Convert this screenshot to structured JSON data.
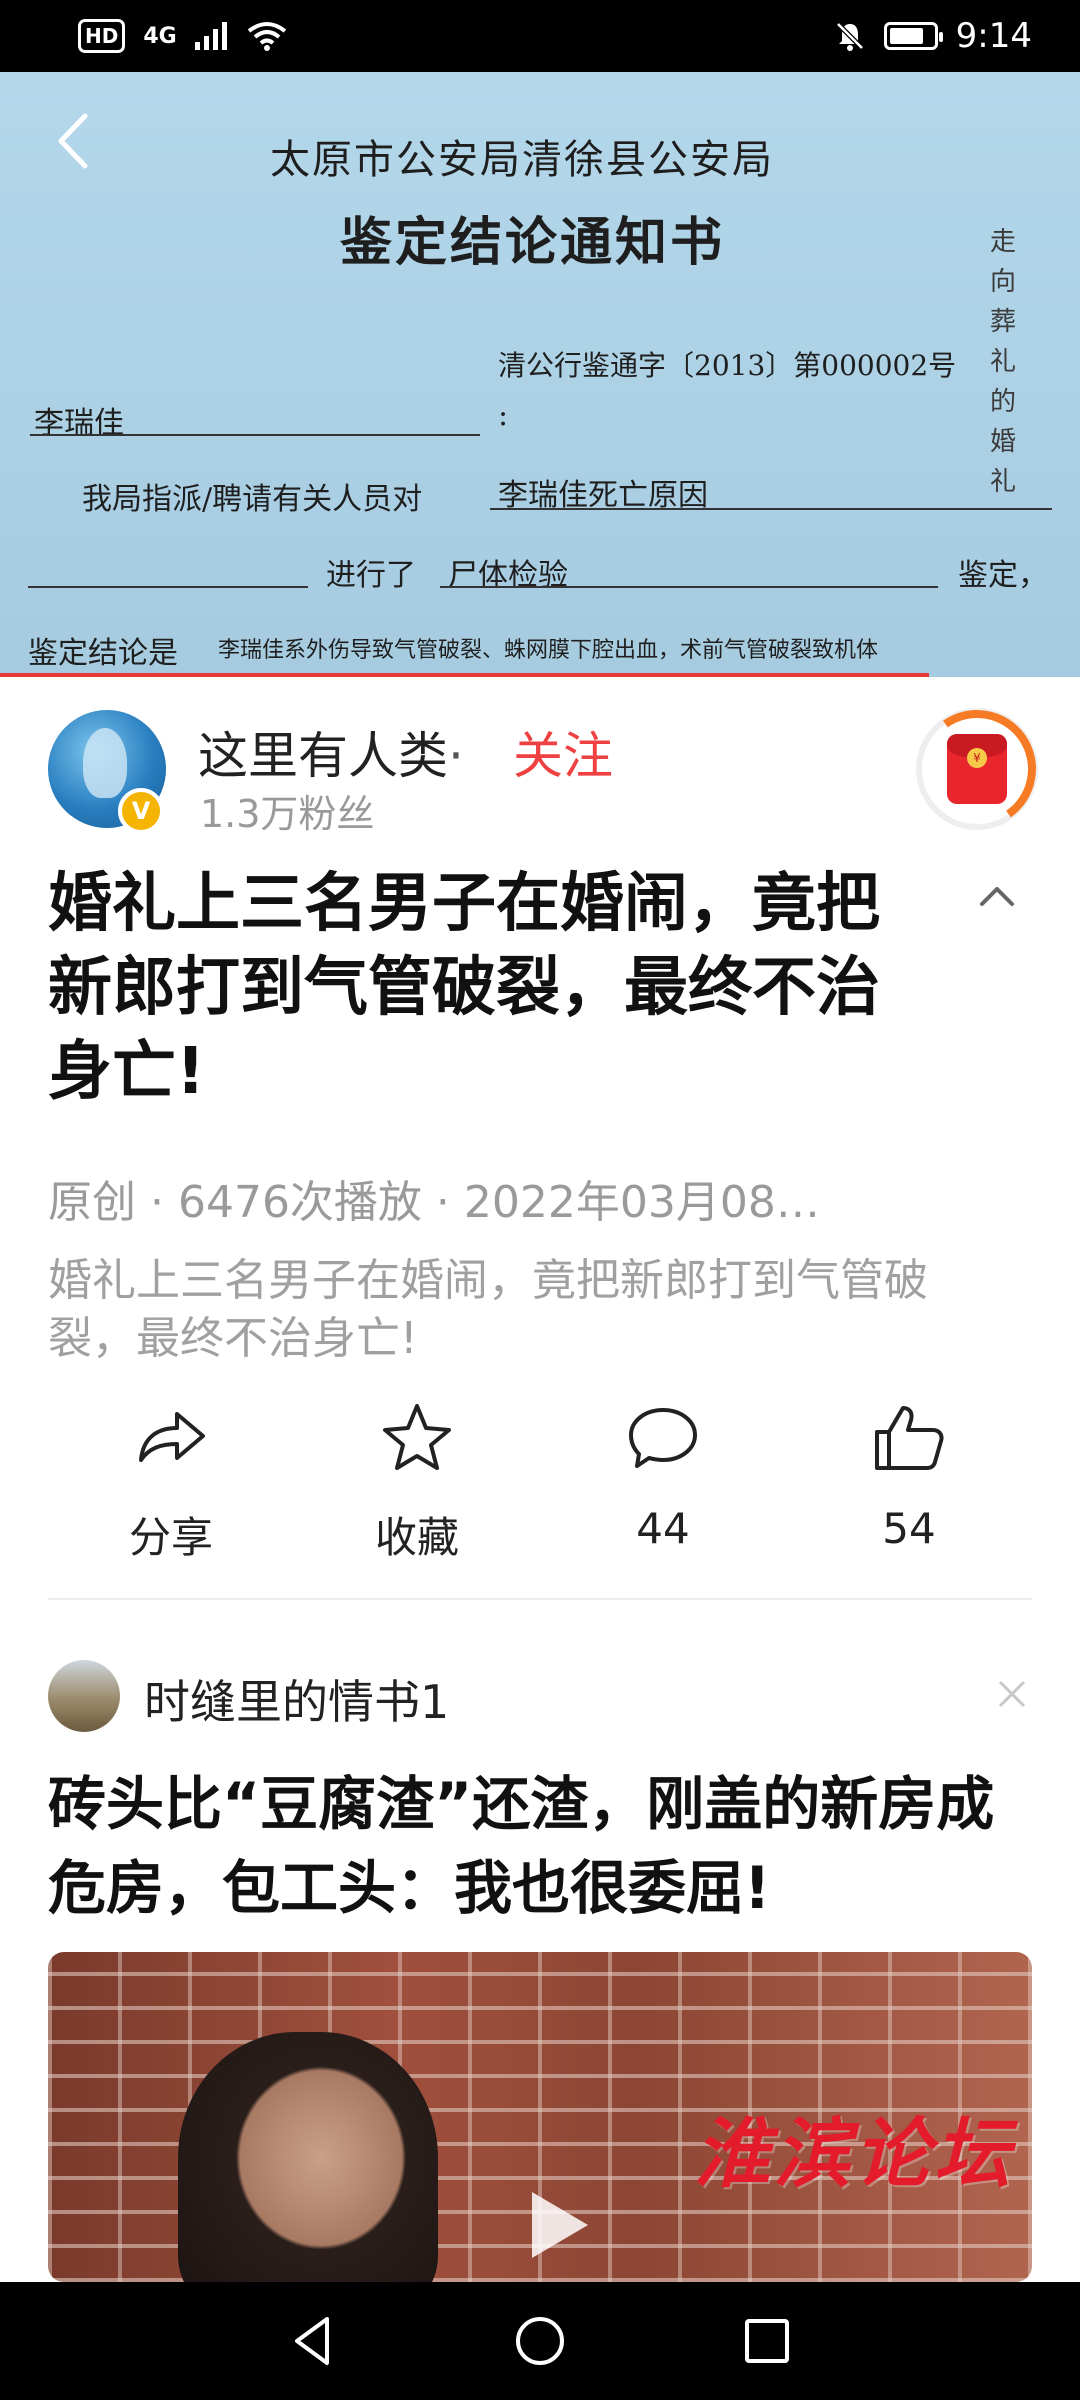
{
  "status_bar": {
    "badge": "HD",
    "network": "4G",
    "time": "9:14",
    "battery_level_percent": 80
  },
  "video": {
    "doc_title_1": "太原市公安局清徐县公安局",
    "doc_title_2": "鉴定结论通知书",
    "doc_number": "清公行鉴通字〔2013〕第000002号",
    "recipient": "李瑞佳",
    "line_1_prefix": "我局指派/聘请有关人员对",
    "line_1_value": "李瑞佳死亡原因",
    "line_2_prefix": "进行了",
    "line_2_value": "尸体检验",
    "line_2_suffix": "鉴定，",
    "line_3_prefix": "鉴定结论是",
    "line_3_value": "李瑞佳系外伤导致气管破裂、蛛网膜下腔出血，术前气管破裂致机体",
    "side_caption": "走向葬礼的婚礼",
    "progress": 0.86
  },
  "author": {
    "name": "这里有人类",
    "separator": "·",
    "follow_label": "关注",
    "fans": "1.3万粉丝"
  },
  "article": {
    "title": "婚礼上三名男子在婚闹，竟把新郎打到气管破裂，最终不治身亡!",
    "meta": "原创 · 6476次播放 · 2022年03月08…",
    "description": "婚礼上三名男子在婚闹，竟把新郎打到气管破裂，最终不治身亡!"
  },
  "actions": {
    "share": "分享",
    "favorite": "收藏",
    "comments": "44",
    "likes": "54"
  },
  "feed_item": {
    "author": "时缝里的情书1",
    "title": "砖头比“豆腐渣”还渣，刚盖的新房成危房，包工头：我也很委屈!",
    "watermark": "淮滨论坛"
  },
  "colors": {
    "accent": "#f04142",
    "status_bar_bg": "#000000",
    "video_bg": "#a9cfe4"
  },
  "icons": [
    "back-icon",
    "collapse-icon",
    "share-icon",
    "star-icon",
    "comment-icon",
    "like-icon",
    "close-icon",
    "play-icon",
    "nav-back-icon",
    "nav-home-icon",
    "nav-recents-icon"
  ]
}
